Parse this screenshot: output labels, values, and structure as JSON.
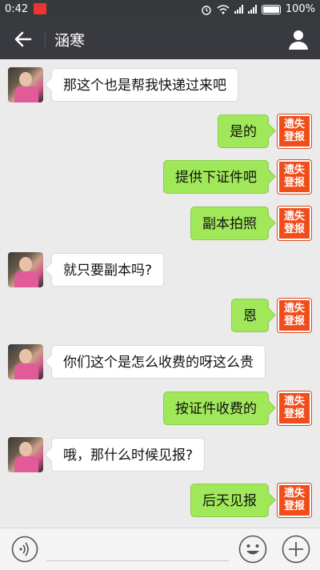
{
  "status_bar": {
    "time": "0:42",
    "battery": "100%"
  },
  "header": {
    "title": "涵寒"
  },
  "badge": {
    "line1": "遗失",
    "line2": "登报"
  },
  "messages": [
    {
      "side": "left",
      "text": "那这个也是帮我快递过来吧"
    },
    {
      "side": "right",
      "text": "是的"
    },
    {
      "side": "right",
      "text": "提供下证件吧"
    },
    {
      "side": "right",
      "text": "副本拍照"
    },
    {
      "side": "left",
      "text": "就只要副本吗?"
    },
    {
      "side": "right",
      "text": "恩"
    },
    {
      "side": "left",
      "text": "你们这个是怎么收费的呀这么贵"
    },
    {
      "side": "right",
      "text": "按证件收费的"
    },
    {
      "side": "left",
      "text": "哦，那什么时候见报?"
    },
    {
      "side": "right",
      "text": "后天见报"
    }
  ],
  "colors": {
    "titlebar": "#393a3f",
    "my_bubble": "#a0e75a",
    "badge": "#f04d1a"
  }
}
